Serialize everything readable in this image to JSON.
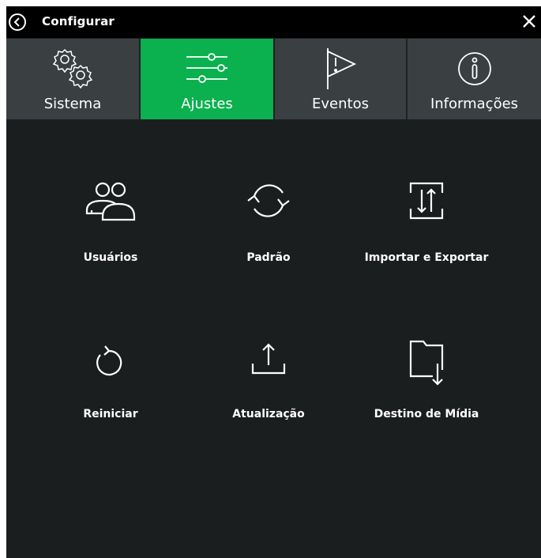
{
  "header": {
    "title": "Configurar"
  },
  "tabs": [
    {
      "label": "Sistema",
      "icon": "gears-icon",
      "active": false
    },
    {
      "label": "Ajustes",
      "icon": "sliders-icon",
      "active": true
    },
    {
      "label": "Eventos",
      "icon": "flag-alert-icon",
      "active": false
    },
    {
      "label": "Informações",
      "icon": "info-icon",
      "active": false
    }
  ],
  "items": [
    {
      "label": "Usuários",
      "icon": "users-icon"
    },
    {
      "label": "Padrão",
      "icon": "refresh-icon"
    },
    {
      "label": "Importar e Exportar",
      "icon": "import-export-icon"
    },
    {
      "label": "Reiniciar",
      "icon": "restart-icon"
    },
    {
      "label": "Atualização",
      "icon": "upload-icon"
    },
    {
      "label": "Destino de Mídia",
      "icon": "folder-download-icon"
    }
  ],
  "colors": {
    "accent": "#0bb04f",
    "background": "#1b1e1f",
    "titlebar": "#000000",
    "tab_bg": "#3a3f42"
  }
}
